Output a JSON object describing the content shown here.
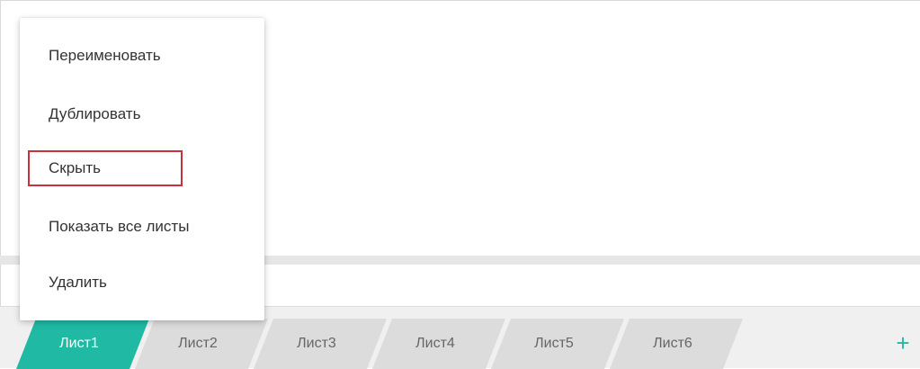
{
  "context_menu": {
    "items": [
      {
        "label": "Переименовать"
      },
      {
        "label": "Дублировать"
      },
      {
        "label": "Скрыть"
      },
      {
        "label": "Показать все листы"
      },
      {
        "label": "Удалить"
      }
    ]
  },
  "tabs": [
    {
      "label": "Лист1",
      "active": true
    },
    {
      "label": "Лист2",
      "active": false
    },
    {
      "label": "Лист3",
      "active": false
    },
    {
      "label": "Лист4",
      "active": false
    },
    {
      "label": "Лист5",
      "active": false
    },
    {
      "label": "Лист6",
      "active": false
    }
  ],
  "add_sheet": {
    "icon": "plus-icon",
    "glyph": "+"
  },
  "colors": {
    "accent": "#1fb9a4",
    "highlight_border": "#c6313a"
  }
}
